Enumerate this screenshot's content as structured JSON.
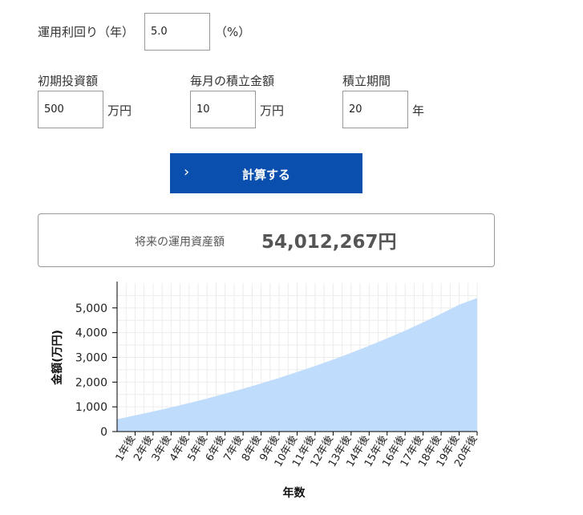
{
  "rate": {
    "label": "運用利回り（年）",
    "value": "5.0",
    "unit": "（%）"
  },
  "initial": {
    "label": "初期投資額",
    "value": "500",
    "unit": "万円"
  },
  "monthly": {
    "label": "毎月の積立金額",
    "value": "10",
    "unit": "万円"
  },
  "period": {
    "label": "積立期間",
    "value": "20",
    "unit": "年"
  },
  "button": {
    "label": "計算する",
    "icon": "chevron-right-icon"
  },
  "result": {
    "label": "将来の運用資産額",
    "value": "54,012,267円"
  },
  "colors": {
    "accent": "#0b4fae",
    "area_fill": "#bfdcfc"
  },
  "chart_data": {
    "type": "area",
    "categories": [
      "1年後",
      "2年後",
      "3年後",
      "4年後",
      "5年後",
      "6年後",
      "7年後",
      "8年後",
      "9年後",
      "10年後",
      "11年後",
      "12年後",
      "13年後",
      "14年後",
      "15年後",
      "16年後",
      "17年後",
      "18年後",
      "19年後",
      "20年後"
    ],
    "values": [
      500,
      651,
      810,
      977,
      1152,
      1337,
      1530,
      1733,
      1946,
      2170,
      2405,
      2652,
      2911,
      3183,
      3469,
      3769,
      4084,
      4415,
      4763,
      5128,
      5400
    ],
    "xlabel": "年数",
    "ylabel": "金額(万円)",
    "ylim": [
      0,
      6000
    ],
    "yticks": [
      0,
      1000,
      2000,
      3000,
      4000,
      5000
    ],
    "ytick_labels": [
      "0",
      "1,000",
      "2,000",
      "3,000",
      "4,000",
      "5,000"
    ],
    "grid": true
  }
}
